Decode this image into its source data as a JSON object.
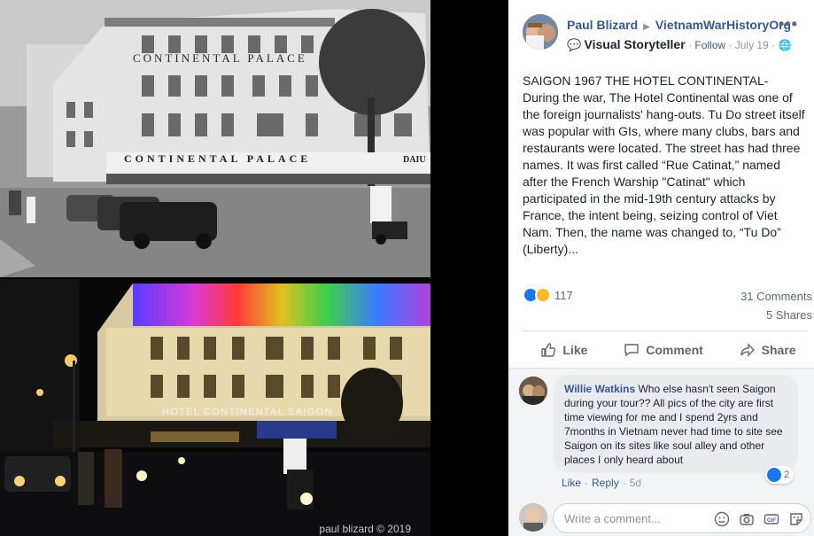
{
  "photo": {
    "top_sign_facade": "CONTINENTAL PALACE",
    "top_sign_awning": "CONTINENTAL PALACE",
    "top_sign_right": "DAIU",
    "bottom_sign": "HOTEL CONTINENTAL SAIGON",
    "watermark": "paul blizard © 2019"
  },
  "post": {
    "author": "Paul Blizard",
    "group": "VietnamWarHistoryOrg",
    "more": "•••",
    "badge": "Visual Storyteller",
    "follow": "Follow",
    "date": "July 19",
    "separator": "·",
    "text": "SAIGON 1967 THE HOTEL CONTINENTAL- During the war, The Hotel Continental was one of the foreign journalists' hang-outs. Tu Do street itself was popular with GIs, where many clubs, bars and restaurants were located. The street has had three names. It was first called “Rue Catinat,” named after the French Warship \"Catinat\" which participated in the mid-19th century attacks by France, the intent being, seizing control of Viet Nam. Then, the name was changed to, “Tu Do” (Liberty)...",
    "reaction_count": "117",
    "comments_count": "31 Comments",
    "shares_count": "5 Shares",
    "colors": {
      "link": "#385898",
      "like": "#1877f2",
      "wow": "#f7b928"
    }
  },
  "actions": {
    "like": "Like",
    "comment": "Comment",
    "share": "Share"
  },
  "comment": {
    "author": "Willie Watkins",
    "text": "Who else hasn't seen Saigon during your tour?? All pics of the city are first time viewing for me and I spend 2yrs and 7months in Vietnam never had time to site see Saigon on its sites like soul alley and other places I only heard about",
    "reaction_count": "2",
    "like": "Like",
    "reply": "Reply",
    "dot": "·",
    "time": "5d"
  },
  "composer": {
    "placeholder": "Write a comment...",
    "icons": [
      "emoji-icon",
      "camera-icon",
      "gif-icon",
      "sticker-icon"
    ],
    "gif_label": "GIF"
  }
}
